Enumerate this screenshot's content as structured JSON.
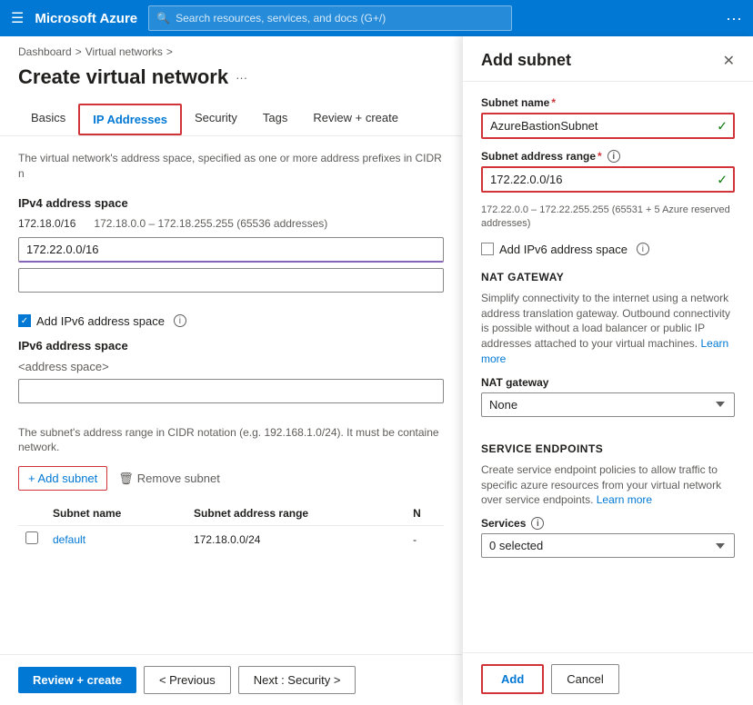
{
  "nav": {
    "hamburger": "☰",
    "title": "Microsoft Azure",
    "search_placeholder": "Search resources, services, and docs (G+/)",
    "dots": "···"
  },
  "breadcrumb": {
    "dashboard": "Dashboard",
    "separator1": ">",
    "virtual_networks": "Virtual networks",
    "separator2": ">"
  },
  "page": {
    "title": "Create virtual network",
    "dots": "···"
  },
  "tabs": [
    {
      "id": "basics",
      "label": "Basics"
    },
    {
      "id": "ip-addresses",
      "label": "IP Addresses",
      "active": true
    },
    {
      "id": "security",
      "label": "Security"
    },
    {
      "id": "tags",
      "label": "Tags"
    },
    {
      "id": "review-create",
      "label": "Review + create"
    }
  ],
  "content": {
    "desc": "The virtual network's address space, specified as one or more address prefixes in CIDR n",
    "ipv4_section_label": "IPv4 address space",
    "address_main": "172.18.0/16",
    "address_range": "172.18.0.0 – 172.18.255.255 (65536 addresses)",
    "input_value": "172.22.0.0/16",
    "input_empty": "",
    "checkbox_label": "Add IPv6 address space",
    "ipv6_section_label": "IPv6 address space",
    "address_space_placeholder": "<address space>",
    "subnet_desc": "The subnet's address range in CIDR notation (e.g. 192.168.1.0/24). It must be containe network.",
    "subnet_desc_link": "network.",
    "add_subnet_btn": "+ Add subnet",
    "remove_subnet_btn": "Remove subnet",
    "table_headers": [
      "",
      "Subnet name",
      "Subnet address range",
      "N"
    ],
    "table_rows": [
      {
        "checked": false,
        "name": "default",
        "range": "172.18.0.0/24",
        "col4": "-"
      }
    ]
  },
  "footer": {
    "review_create": "Review + create",
    "previous": "< Previous",
    "next": "Next : Security >"
  },
  "panel": {
    "title": "Add subnet",
    "close": "✕",
    "subnet_name_label": "Subnet name",
    "required_marker": "*",
    "subnet_name_value": "AzureBastionSubnet",
    "subnet_address_label": "Subnet address range",
    "subnet_address_value": "172.22.0.0/16",
    "address_hint": "172.22.0.0 – 172.22.255.255 (65531 + 5 Azure reserved addresses)",
    "ipv6_checkbox_label": "Add IPv6 address space",
    "nat_gateway_title": "NAT GATEWAY",
    "nat_desc": "Simplify connectivity to the internet using a network address translation gateway. Outbound connectivity is possible without a load balancer or public IP addresses attached to your virtual machines.",
    "nat_learn_more": "Learn more",
    "nat_gateway_label": "NAT gateway",
    "nat_gateway_value": "None",
    "nat_options": [
      "None"
    ],
    "service_endpoints_title": "SERVICE ENDPOINTS",
    "service_desc": "Create service endpoint policies to allow traffic to specific azure resources from your virtual network over service endpoints.",
    "service_learn_more": "Learn more",
    "services_label": "Services",
    "services_value": "0 selected",
    "services_options": [
      "0 selected"
    ],
    "add_btn": "Add",
    "cancel_btn": "Cancel"
  }
}
